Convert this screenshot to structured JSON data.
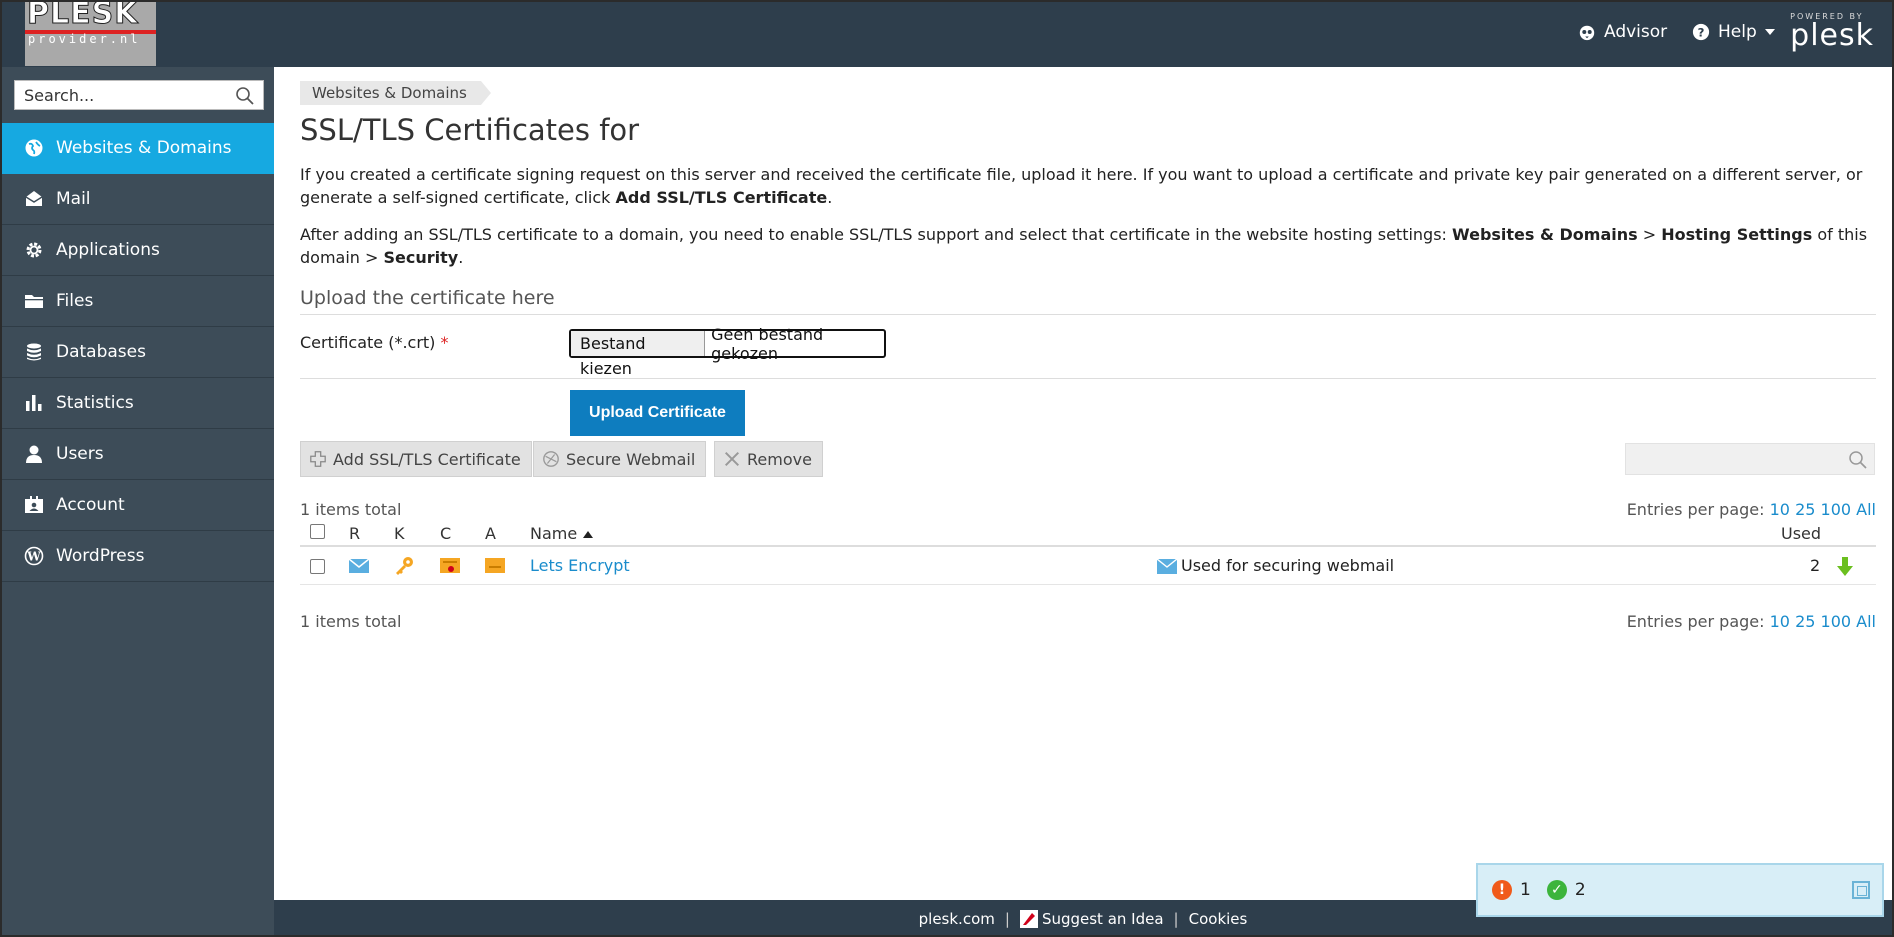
{
  "header": {
    "logo_main": "PLESK",
    "logo_sub": "provider.nl",
    "advisor_label": "Advisor",
    "help_label": "Help",
    "powered_by": "POWERED BY",
    "powered_brand": "plesk"
  },
  "sidebar": {
    "search_placeholder": "Search...",
    "items": [
      {
        "label": "Websites & Domains",
        "icon": "globe-icon",
        "active": true
      },
      {
        "label": "Mail",
        "icon": "mail-icon"
      },
      {
        "label": "Applications",
        "icon": "gear-icon"
      },
      {
        "label": "Files",
        "icon": "folder-icon"
      },
      {
        "label": "Databases",
        "icon": "database-icon"
      },
      {
        "label": "Statistics",
        "icon": "bar-chart-icon"
      },
      {
        "label": "Users",
        "icon": "user-icon"
      },
      {
        "label": "Account",
        "icon": "account-card-icon"
      },
      {
        "label": "WordPress",
        "icon": "wordpress-icon"
      }
    ]
  },
  "main": {
    "breadcrumb": "Websites & Domains",
    "title": "SSL/TLS Certificates for",
    "intro": {
      "p1_text": "If you created a certificate signing request on this server and received the certificate file, upload it here. If you want to upload a certificate and private key pair generated on a different server, or generate a self-signed certificate, click ",
      "p1_bold": "Add SSL/TLS Certificate",
      "p1_end": ".",
      "p2_text": "After adding an SSL/TLS certificate to a domain, you need to enable SSL/TLS support and select that certificate in the website hosting settings: ",
      "p2_bold1": "Websites & Domains",
      "p2_sep1": " > ",
      "p2_bold2": "Hosting Settings",
      "p2_mid": " of this domain > ",
      "p2_bold3": "Security",
      "p2_end": "."
    },
    "upload_section_title": "Upload the certificate here",
    "certificate_label": "Certificate (*.crt)",
    "required_mark": "*",
    "file_choose_label": "Bestand kiezen",
    "file_none_label": "Geen bestand gekozen",
    "upload_button": "Upload Certificate",
    "toolbar": {
      "add_label": "Add SSL/TLS Certificate",
      "webmail_label": "Secure Webmail",
      "remove_label": "Remove"
    },
    "items_total": "1 items total",
    "entries_per_page_label": "Entries per page:",
    "entries_options": [
      "10",
      "25",
      "100",
      "All"
    ],
    "table": {
      "columns": {
        "r": "R",
        "k": "K",
        "c": "C",
        "a": "A",
        "name": "Name",
        "used": "Used"
      },
      "rows": [
        {
          "name": "Lets Encrypt",
          "note": "Used for securing webmail",
          "used": "2"
        }
      ]
    }
  },
  "footer": {
    "link1": "plesk.com",
    "sep": "|",
    "link2": "Suggest an Idea",
    "link3": "Cookies"
  },
  "notifications": {
    "warning_count": "1",
    "ok_count": "2",
    "warning_color": "#f05a1a",
    "ok_color": "#3cb43c"
  },
  "colors": {
    "header_bg": "#2e3e4c",
    "sidebar_bg": "#3d4c58",
    "active_nav": "#16a9e1",
    "primary_button": "#0e7dbf",
    "link": "#1a8ccc"
  }
}
